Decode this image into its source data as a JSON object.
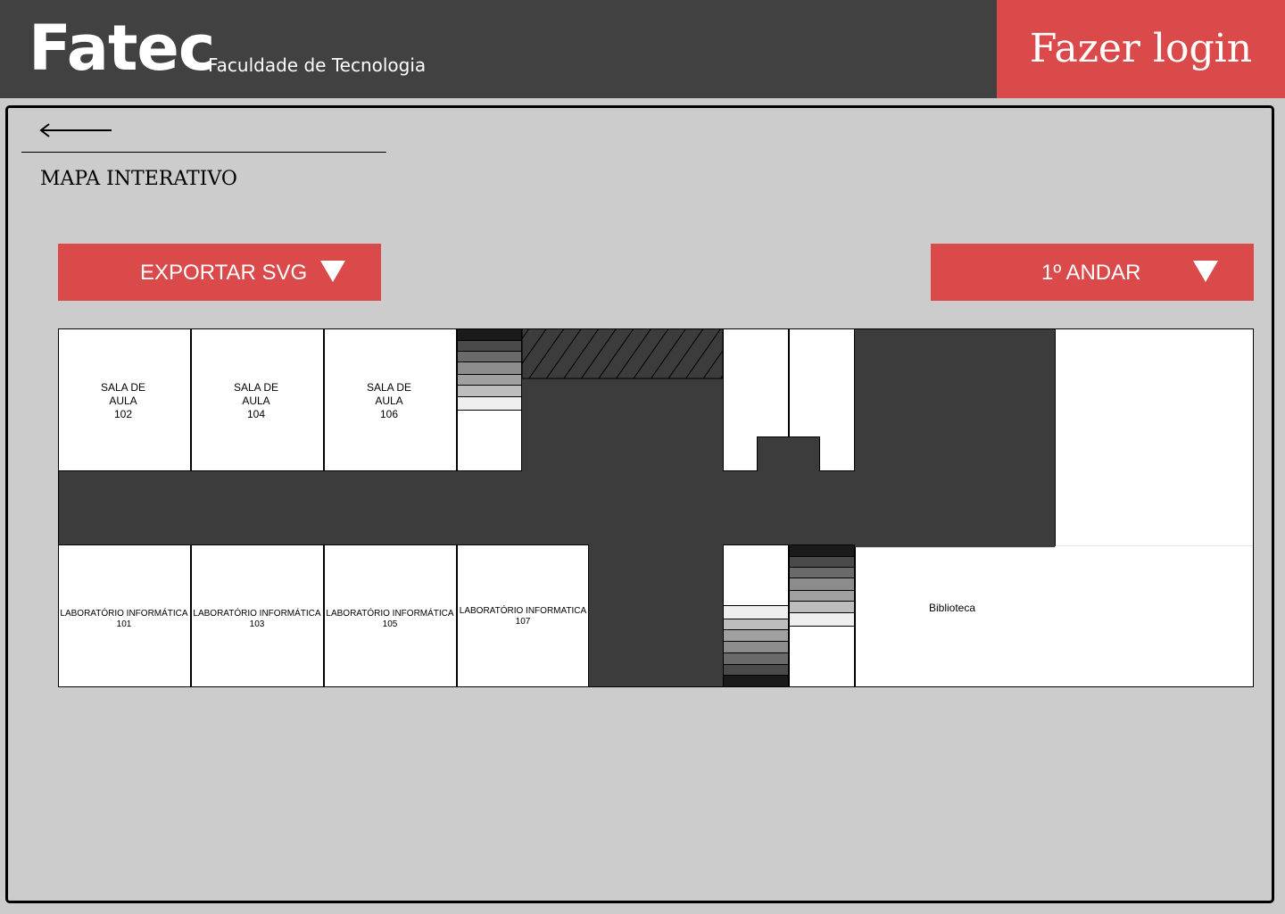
{
  "header": {
    "brand": "Fatec",
    "tagline": "Faculdade de Tecnologia",
    "login_label": "Fazer login"
  },
  "page": {
    "title": "MAPA INTERATIVO",
    "back_icon": "arrow-left-icon"
  },
  "toolbar": {
    "export_label": "EXPORTAR SVG",
    "floor_selected": "1º ANDAR",
    "dropdown_icon": "triangle-down-icon"
  },
  "map": {
    "rooms_top": [
      {
        "lines": [
          "SALA DE",
          "AULA",
          "102"
        ]
      },
      {
        "lines": [
          "SALA DE",
          "AULA",
          "104"
        ]
      },
      {
        "lines": [
          "SALA DE",
          "AULA",
          "106"
        ]
      }
    ],
    "rooms_bottom": [
      {
        "lines": [
          "LABORATÓRIO INFORMÁTICA",
          "101"
        ]
      },
      {
        "lines": [
          "LABORATÓRIO INFORMÁTICA",
          "103"
        ]
      },
      {
        "lines": [
          "LABORATÓRIO INFORMÁTICA",
          "105"
        ]
      },
      {
        "lines": [
          "LABORATÓRIO INFORMATICA",
          "107"
        ]
      }
    ],
    "library": "Biblioteca"
  },
  "colors": {
    "accent": "#db4a4a",
    "header_bg": "#414141",
    "page_bg": "#cccccc",
    "corridor": "#3c3c3c"
  }
}
